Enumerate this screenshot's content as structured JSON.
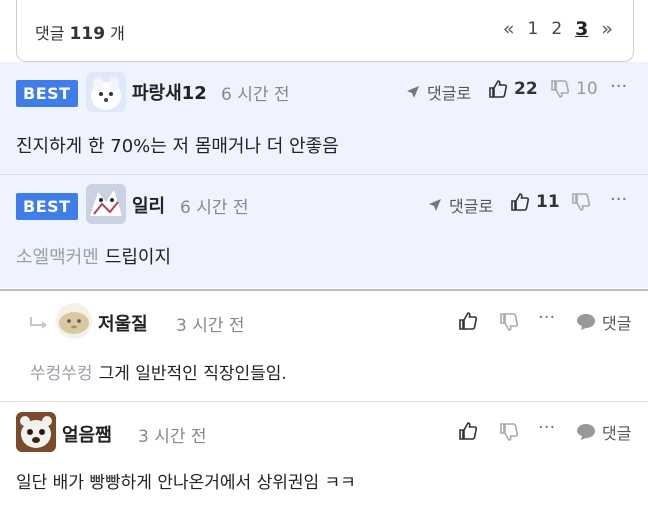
{
  "header": {
    "count_prefix": "댓글",
    "count_value": "119",
    "count_suffix": "개",
    "pager": {
      "first": "«",
      "pages": [
        "1",
        "2",
        "3"
      ],
      "current": "3",
      "last": "»"
    }
  },
  "comments": [
    {
      "badge": "BEST",
      "nickname": "파랑새12",
      "time": "6 시간 전",
      "reply_label": "댓글로",
      "likes": "22",
      "dislikes": "10",
      "tag": "",
      "text": "진지하게 한 70%는 저 몸매거나 더 안좋음"
    },
    {
      "badge": "BEST",
      "nickname": "일리",
      "time": "6 시간 전",
      "reply_label": "댓글로",
      "likes": "11",
      "dislikes": "",
      "tag": "소엘맥커멘",
      "text": "드립이지"
    },
    {
      "nickname": "저울질",
      "time": "3 시간 전",
      "reply_label": "댓글",
      "tag": "쑤컹쑤컹",
      "text": "그게 일반적인 직장인들임."
    },
    {
      "nickname": "얼음쨈",
      "time": "3 시간 전",
      "reply_label": "댓글",
      "tag": "",
      "text": "일단 배가 빵빵하게 안나온거에서 상위권임 ㅋㅋ"
    }
  ],
  "more_label": "···",
  "colors": {
    "best_bg": "#eef3ff",
    "badge": "#3f7de8"
  },
  "icons": [
    "thumbs-up-icon",
    "thumbs-down-icon",
    "reply-arrow-icon",
    "speech-bubble-icon",
    "more-dots-icon"
  ]
}
